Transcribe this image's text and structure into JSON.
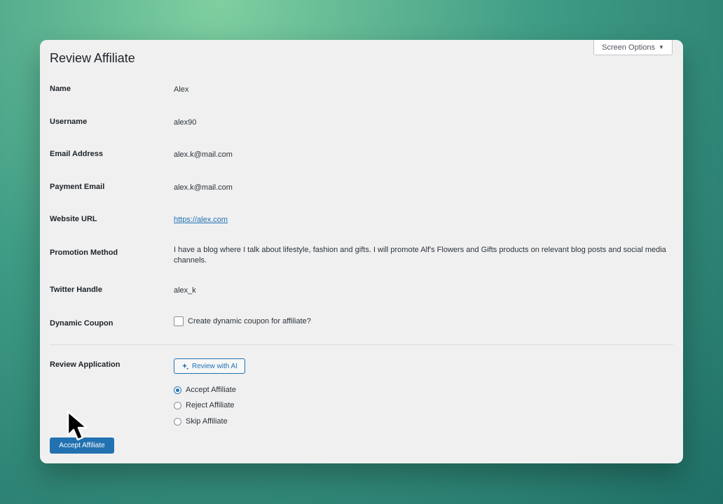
{
  "screen_options": {
    "label": "Screen Options",
    "caret": "▼"
  },
  "page_title": "Review Affiliate",
  "fields": {
    "name": {
      "label": "Name",
      "value": "Alex"
    },
    "username": {
      "label": "Username",
      "value": "alex90"
    },
    "email": {
      "label": "Email Address",
      "value": "alex.k@mail.com"
    },
    "payment_email": {
      "label": "Payment Email",
      "value": "alex.k@mail.com"
    },
    "website": {
      "label": "Website URL",
      "value": "https://alex.com"
    },
    "promotion": {
      "label": "Promotion Method",
      "value": "I have a blog where I talk about lifestyle, fashion and gifts. I will promote Alf's Flowers and Gifts products on relevant blog posts and social media channels."
    },
    "twitter": {
      "label": "Twitter Handle",
      "value": "alex_k"
    },
    "coupon": {
      "label": "Dynamic Coupon",
      "checkbox_label": "Create dynamic coupon for affiliate?",
      "checked": false
    }
  },
  "review": {
    "label": "Review Application",
    "ai_button": "Review with AI",
    "options": [
      "Accept Affiliate",
      "Reject Affiliate",
      "Skip Affiliate"
    ],
    "selected": "Accept Affiliate"
  },
  "submit_button": "Accept Affiliate",
  "colors": {
    "accent": "#2271b1",
    "panel": "#f0f0f1"
  }
}
